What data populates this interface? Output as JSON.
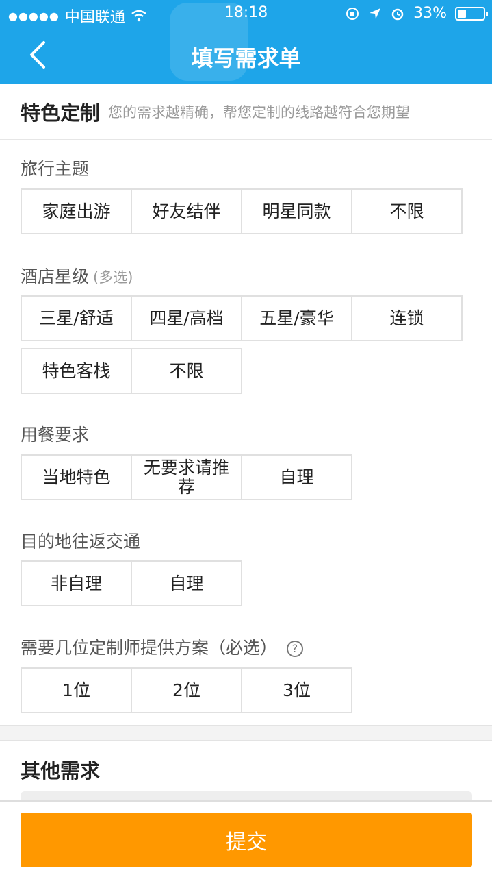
{
  "status_bar": {
    "signal": "●●●●●",
    "carrier": "中国联通",
    "time": "18:18",
    "battery": "33%",
    "battery_level": 0.33
  },
  "header": {
    "title": "填写需求单"
  },
  "custom_section": {
    "title": "特色定制",
    "subtitle": "您的需求越精确，帮您定制的线路越符合您期望"
  },
  "travel_theme": {
    "label": "旅行主题",
    "options": [
      "家庭出游",
      "好友结伴",
      "明星同款",
      "不限"
    ]
  },
  "hotel_level": {
    "label": "酒店星级",
    "hint": "(多选)",
    "options_row1": [
      "三星/舒适",
      "四星/高档",
      "五星/豪华",
      "连锁"
    ],
    "options_row2": [
      "特色客栈",
      "不限"
    ]
  },
  "dining": {
    "label": "用餐要求",
    "options": [
      "当地特色",
      "无要求请推荐",
      "自理"
    ]
  },
  "transport": {
    "label": "目的地往返交通",
    "options": [
      "非自理",
      "自理"
    ]
  },
  "planners": {
    "label": "需要几位定制师提供方案（必选）",
    "help_icon": "?",
    "options": [
      "1位",
      "2位",
      "3位"
    ]
  },
  "other": {
    "title": "其他需求"
  },
  "submit": {
    "label": "提交"
  },
  "colors": {
    "header": "#1ea5e9",
    "submit": "#ff9800"
  }
}
